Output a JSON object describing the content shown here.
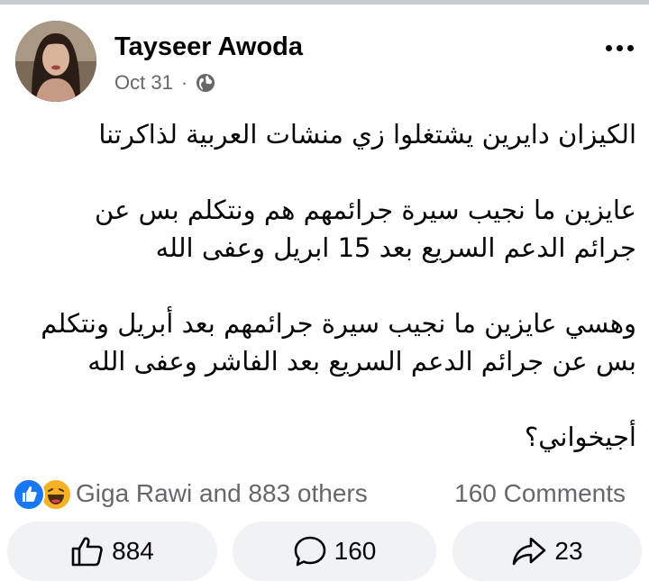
{
  "post": {
    "author": "Tayseer Awoda",
    "date": "Oct 31",
    "separator": "·",
    "privacy_icon": "globe-icon",
    "paragraphs": [
      [
        "الكيزان دايرين يشتغلوا زي منشات العربية لذاكرتنا"
      ],
      [
        "عايزين ما نجيب سيرة جرائمهم هم ونتكلم بس عن",
        "جرائم الدعم السريع بعد 15 ابريل وعفى الله"
      ],
      [
        "وهسي عايزين ما نجيب سيرة جرائمهم بعد أبريل ونتكلم",
        "بس عن جرائم الدعم السريع بعد الفاشر وعفى الله"
      ],
      [
        "أجيخواني؟"
      ]
    ]
  },
  "reactions": {
    "icons": [
      "like-reaction-icon",
      "haha-reaction-icon"
    ],
    "summary": "Giga Rawi and 883 others",
    "comments_summary": "160 Comments"
  },
  "actions": {
    "like_count": "884",
    "comment_count": "160",
    "share_count": "23"
  },
  "colors": {
    "like_blue": "#1877f2",
    "haha_yellow": "#f7b125",
    "secondary_text": "#65676b",
    "button_bg": "#f0f2f5"
  }
}
